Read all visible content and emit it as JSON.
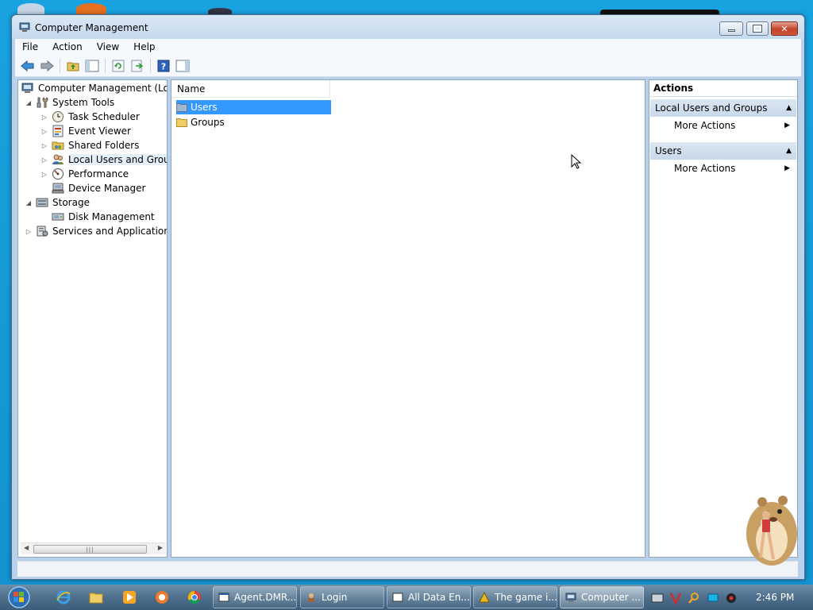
{
  "window": {
    "title": "Computer Management"
  },
  "menu": [
    "File",
    "Action",
    "View",
    "Help"
  ],
  "toolbar_icons": [
    "back-icon",
    "forward-icon",
    "up-folder-icon",
    "show-hide-tree-icon",
    "refresh-icon",
    "export-list-icon",
    "help-icon",
    "show-hide-action-pane-icon"
  ],
  "tree": {
    "root": "Computer Management (Local",
    "items": [
      {
        "label": "System Tools",
        "level": 1,
        "expander": "expanded"
      },
      {
        "label": "Task Scheduler",
        "level": 2,
        "expander": "collapsed"
      },
      {
        "label": "Event Viewer",
        "level": 2,
        "expander": "collapsed"
      },
      {
        "label": "Shared Folders",
        "level": 2,
        "expander": "collapsed"
      },
      {
        "label": "Local Users and Groups",
        "level": 2,
        "expander": "collapsed",
        "selected": true
      },
      {
        "label": "Performance",
        "level": 2,
        "expander": "collapsed"
      },
      {
        "label": "Device Manager",
        "level": 2,
        "expander": "none"
      },
      {
        "label": "Storage",
        "level": 1,
        "expander": "expanded"
      },
      {
        "label": "Disk Management",
        "level": 2,
        "expander": "none"
      },
      {
        "label": "Services and Applications",
        "level": 1,
        "expander": "collapsed"
      }
    ]
  },
  "list": {
    "column_header": "Name",
    "rows": [
      {
        "name": "Users",
        "selected": true
      },
      {
        "name": "Groups",
        "selected": false
      }
    ]
  },
  "actions": {
    "header": "Actions",
    "groups": [
      {
        "title": "Local Users and Groups",
        "item": "More Actions"
      },
      {
        "title": "Users",
        "item": "More Actions"
      }
    ]
  },
  "taskbar": {
    "buttons": [
      {
        "label": "Agent.DMR...",
        "active": false
      },
      {
        "label": "Login",
        "active": false
      },
      {
        "label": "All Data En...",
        "active": false
      },
      {
        "label": "The game i...",
        "active": false
      },
      {
        "label": "Computer ...",
        "active": true
      }
    ],
    "clock": "2:46 PM"
  },
  "colors": {
    "selection": "#3399ff",
    "desktop": "#18a3e0",
    "window_frame": "#b9d1ea"
  }
}
